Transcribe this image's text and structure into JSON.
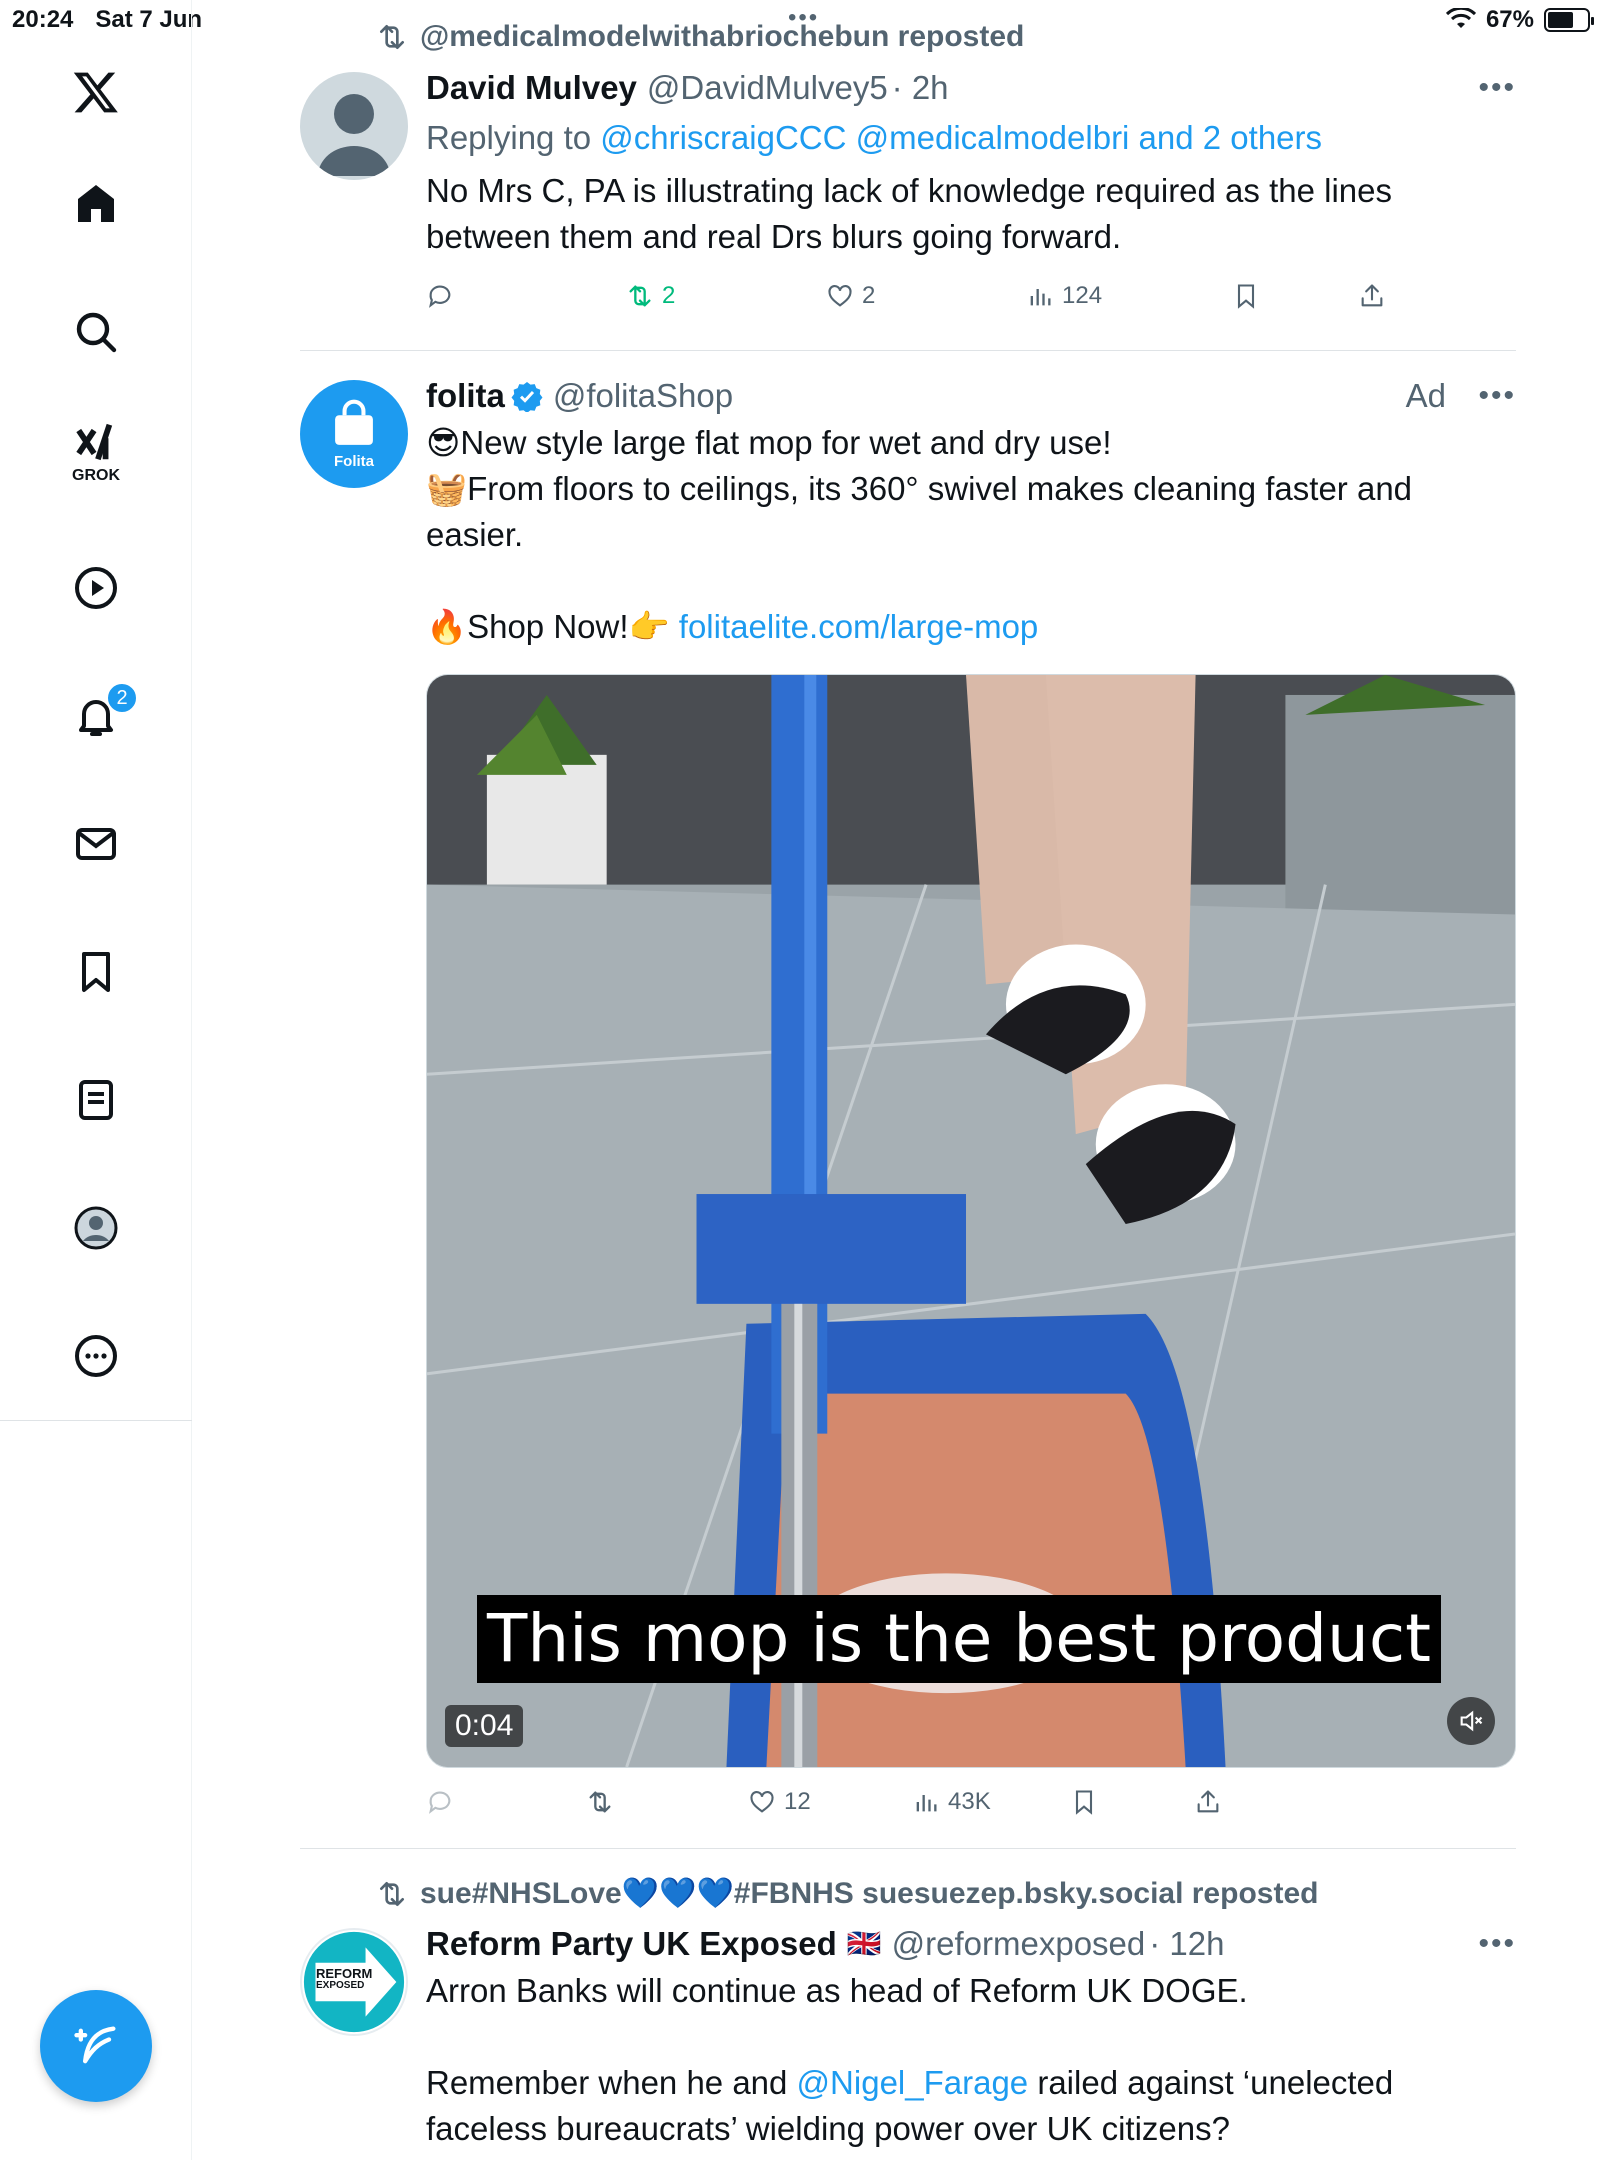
{
  "status_bar": {
    "time": "20:24",
    "date": "Sat 7 Jun",
    "battery": "67%",
    "battery_level": 0.67
  },
  "sidebar": {
    "grok_label": "GROK",
    "notifications_badge": "2",
    "items": [
      "x-logo-icon",
      "home-icon",
      "search-icon",
      "grok-icon",
      "video-icon",
      "notifications-icon",
      "messages-icon",
      "bookmarks-icon",
      "lists-icon",
      "profile-icon",
      "more-icon"
    ]
  },
  "posts": [
    {
      "repost_by": "@medicalmodelwithabriochebun reposted",
      "name": "David Mulvey",
      "handle": "@DavidMulvey5",
      "time": "· 2h",
      "replying_prefix": "Replying to ",
      "replying_to": "@chriscraigCCC @medicalmodelbri and 2 others",
      "text": "No Mrs C, PA is illustrating lack of knowledge required as the lines between them and real Drs blurs going forward.",
      "stats": {
        "reposts": "2",
        "likes": "2",
        "views": "124"
      }
    },
    {
      "name": "folita",
      "handle": "@folitaShop",
      "ad_label": "Ad",
      "avatar_text": "Folita",
      "line1": "😎New style large flat mop for wet and dry use!",
      "line2": "🧺From floors to ceilings, its 360° swivel makes cleaning faster and easier.",
      "line3_prefix": "🔥Shop Now!👉 ",
      "link": "folitaelite.com/large-mop",
      "video_caption": "This mop is the best product",
      "video_time": "0:04",
      "stats": {
        "likes": "12",
        "views": "43K"
      }
    },
    {
      "repost_by": "sue#NHSLove💙💙💙#FBNHS suesuezep.bsky.social reposted",
      "name": "Reform Party UK Exposed",
      "flag": "🇬🇧",
      "handle": "@reformexposed",
      "time": "· 12h",
      "avatar_text_1": "REFORM",
      "avatar_text_2": "EXPOSED",
      "text1": "Arron Banks will continue as head of Reform UK DOGE.",
      "text2_prefix": "Remember when he and ",
      "mention": "@Nigel_Farage",
      "text2_suffix": " railed against ‘unelected faceless bureaucrats’ wielding power over UK citizens?"
    }
  ],
  "colors": {
    "accent": "#1d9bf0",
    "repost_green": "#00ba7c",
    "secondary_text": "#536471"
  }
}
